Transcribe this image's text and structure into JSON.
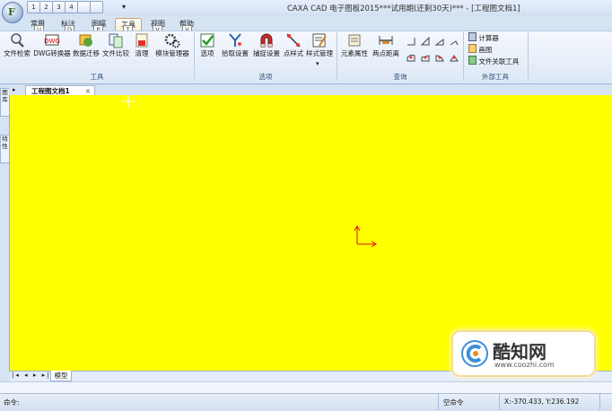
{
  "window": {
    "title": "CAXA CAD 电子图板2015***试用期(还剩30天)*** - [工程图文档1]",
    "app_letter": "F"
  },
  "quick_access": [
    "1",
    "2",
    "3",
    "4",
    "",
    ""
  ],
  "tabs": [
    {
      "label": "常用",
      "key": "U"
    },
    {
      "label": "标注",
      "key": "D"
    },
    {
      "label": "图幅",
      "key": "P"
    },
    {
      "label": "工具",
      "key": "T"
    },
    {
      "label": "视图",
      "key": "V"
    },
    {
      "label": "帮助",
      "key": "V"
    }
  ],
  "ribbon": {
    "tools": {
      "group": "工具",
      "buttons": [
        "文件检索",
        "DWG转换器",
        "数据迁移",
        "文件比较",
        "清理",
        "模块管理器"
      ]
    },
    "options": {
      "group": "选项",
      "buttons": [
        "选项",
        "拾取设置",
        "捕捉设置",
        "点样式",
        "样式管理"
      ]
    },
    "query": {
      "group": "查询",
      "buttons": [
        "元素属性",
        "两点距离"
      ]
    },
    "external": {
      "group": "外部工具",
      "items": [
        "计算器",
        "画图",
        "文件关联工具"
      ]
    }
  },
  "document_tab": {
    "label": "工程图文档1",
    "close": "×"
  },
  "side_tabs": [
    "图库",
    "特性"
  ],
  "model_tab": "模型",
  "status": {
    "command_label": "命令:",
    "mode": "空命令",
    "coords": "X:-370.433, Y:236.192"
  },
  "watermark": {
    "logo": "酷知网",
    "url": "www.coozhi.com"
  },
  "colors": {
    "canvas": "#ffff00",
    "ribbon_accent": "#2e4e7d",
    "axis_x": "#d11",
    "axis_y": "#d11"
  }
}
